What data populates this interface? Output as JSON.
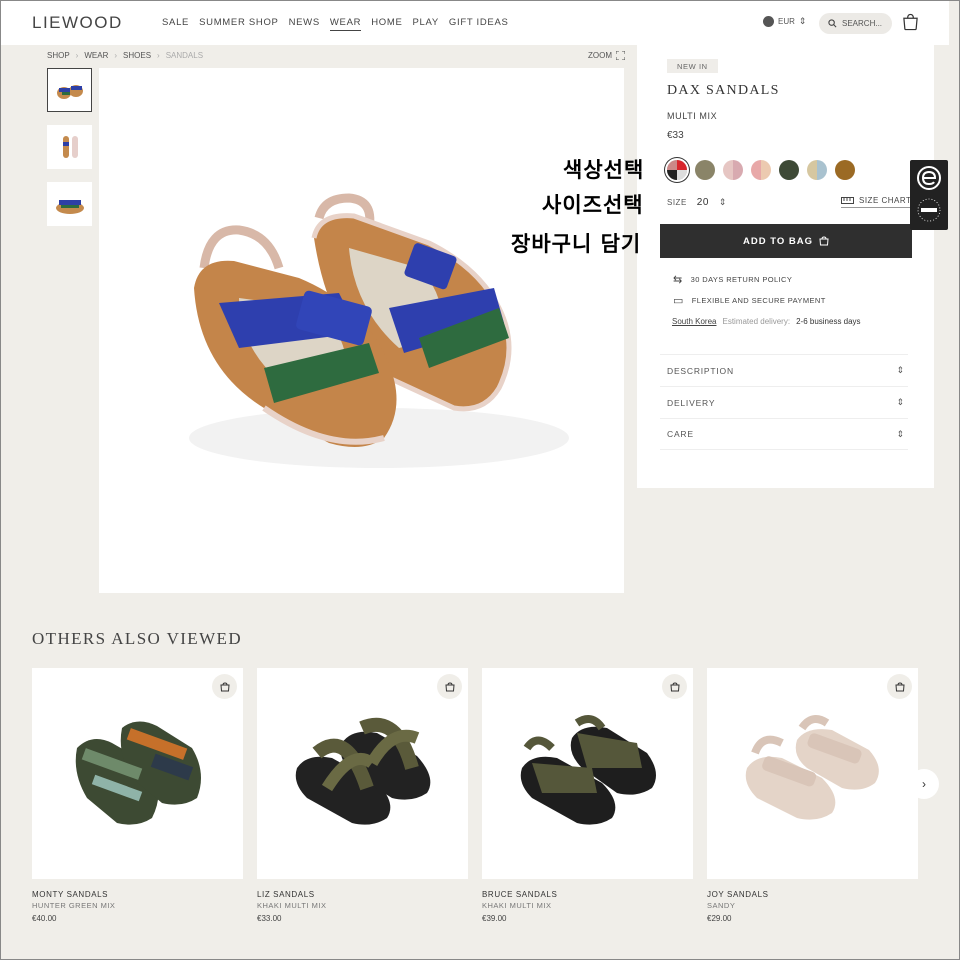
{
  "header": {
    "logo": "LIEWOOD",
    "nav": [
      "SALE",
      "SUMMER SHOP",
      "NEWS",
      "WEAR",
      "HOME",
      "PLAY",
      "GIFT IDEAS"
    ],
    "currency": "EUR",
    "search_placeholder": "SEARCH..."
  },
  "breadcrumb": [
    "SHOP",
    "WEAR",
    "SHOES",
    "SANDALS"
  ],
  "zoom_label": "ZOOM",
  "product": {
    "badge": "NEW IN",
    "title": "DAX SANDALS",
    "color_name": "MULTI MIX",
    "price": "€33",
    "swatches": [
      "multi",
      "#8a8468",
      "#e6c6c3",
      "#eccab0",
      "#3e4a36",
      "#a9c2cf",
      "#9b6a24"
    ],
    "size_label": "SIZE",
    "size_value": "20",
    "size_chart": "SIZE CHART",
    "add_to_bag": "ADD TO BAG",
    "return_policy": "30 DAYS RETURN POLICY",
    "payment": "FLEXIBLE AND SECURE PAYMENT",
    "country": "South Korea",
    "delivery_label": "Estimated delivery:",
    "delivery_days": "2-6 business days",
    "accordions": [
      "DESCRIPTION",
      "DELIVERY",
      "CARE"
    ]
  },
  "annotations": {
    "color_select": "색상선택",
    "size_select": "사이즈선택",
    "add_cart": "장바구니 담기"
  },
  "others": {
    "title": "OTHERS ALSO VIEWED",
    "items": [
      {
        "name": "MONTY SANDALS",
        "sub": "HUNTER GREEN MIX",
        "price": "€40.00"
      },
      {
        "name": "LIZ SANDALS",
        "sub": "KHAKI MULTI MIX",
        "price": "€33.00"
      },
      {
        "name": "BRUCE SANDALS",
        "sub": "KHAKI MULTI MIX",
        "price": "€39.00"
      },
      {
        "name": "JOY SANDALS",
        "sub": "SANDY",
        "price": "€29.00"
      }
    ]
  }
}
